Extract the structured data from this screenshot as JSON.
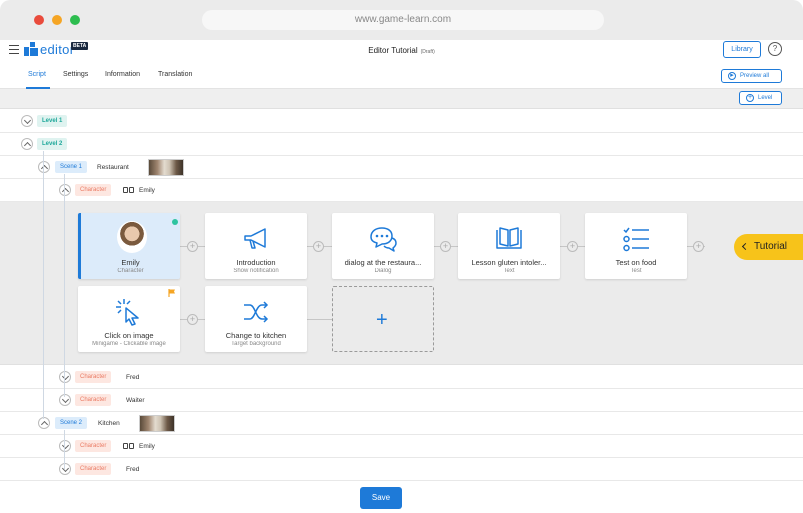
{
  "browser": {
    "url": "www.game-learn.com"
  },
  "header": {
    "logo_text": "editor",
    "beta_badge": "BETA",
    "title": "Editor Tutorial",
    "status": "(Draft)",
    "library_label": "Library",
    "help_label": "?"
  },
  "tabs": [
    {
      "label": "Script",
      "active": true
    },
    {
      "label": "Settings"
    },
    {
      "label": "Information"
    },
    {
      "label": "Translation"
    }
  ],
  "actions": {
    "preview_all_label": "Preview all",
    "level_label": "Level"
  },
  "tree": {
    "level1": {
      "tag": "Level 1"
    },
    "level2": {
      "tag": "Level 2"
    },
    "scene1": {
      "tag": "Scene 1",
      "name": "Restaurant"
    },
    "character_emily": {
      "tag": "Character",
      "name": "Emily"
    },
    "character_fred": {
      "tag": "Character",
      "name": "Fred"
    },
    "character_waiter": {
      "tag": "Character",
      "name": "Waiter"
    },
    "scene2": {
      "tag": "Scene 2",
      "name": "Kitchen"
    },
    "scene2_emily": {
      "tag": "Character",
      "name": "Emily"
    },
    "scene2_fred": {
      "tag": "Character",
      "name": "Fred"
    }
  },
  "cards": [
    {
      "title": "Emily",
      "subtitle": "Character"
    },
    {
      "title": "Introduction",
      "subtitle": "Show notification"
    },
    {
      "title": "dialog at the restaura...",
      "subtitle": "Dialog"
    },
    {
      "title": "Lesson gluten intoler...",
      "subtitle": "Text"
    },
    {
      "title": "Test on food",
      "subtitle": "Test"
    },
    {
      "title": "Click on image",
      "subtitle": "Minigame - Clickable image"
    },
    {
      "title": "Change to kitchen",
      "subtitle": "Target background"
    }
  ],
  "side_tab": {
    "label": "Tutorial"
  },
  "footer": {
    "save_label": "Save"
  },
  "colors": {
    "accent": "#1e7ad8",
    "tutorial": "#f7c31a",
    "level_tag": "#1ea89a",
    "character_tag": "#ea7a63"
  }
}
